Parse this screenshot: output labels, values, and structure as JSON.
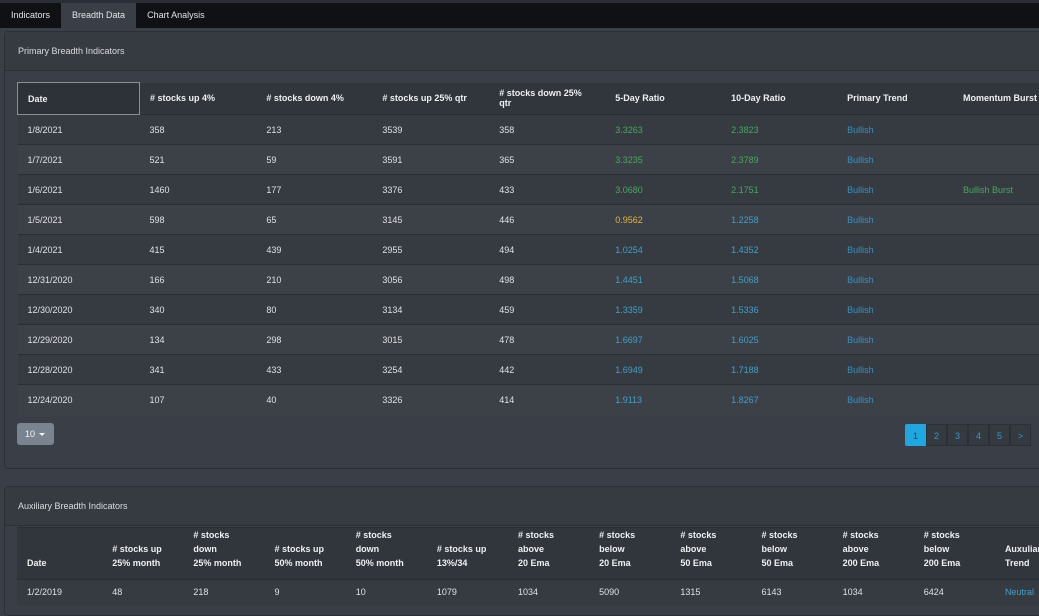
{
  "tabs": [
    {
      "label": "Indicators",
      "active": false
    },
    {
      "label": "Breadth Data",
      "active": true
    },
    {
      "label": "Chart Analysis",
      "active": false
    }
  ],
  "primary": {
    "title": "Primary Breadth Indicators",
    "columns": [
      "Date",
      "# stocks up 4%",
      "# stocks down 4%",
      "# stocks up 25% qtr",
      "# stocks down 25% qtr",
      "5-Day Ratio",
      "10-Day Ratio",
      "Primary Trend",
      "Momentum Burst"
    ],
    "rows": [
      {
        "date": "1/8/2021",
        "up4": "358",
        "down4": "213",
        "up25q": "3539",
        "down25q": "358",
        "r5": "3.3263",
        "r5c": "pos",
        "r10": "2.3823",
        "r10c": "pos",
        "trend": "Bullish",
        "burst": ""
      },
      {
        "date": "1/7/2021",
        "up4": "521",
        "down4": "59",
        "up25q": "3591",
        "down25q": "365",
        "r5": "3.3235",
        "r5c": "pos",
        "r10": "2.3789",
        "r10c": "pos",
        "trend": "Bullish",
        "burst": ""
      },
      {
        "date": "1/6/2021",
        "up4": "1460",
        "down4": "177",
        "up25q": "3376",
        "down25q": "433",
        "r5": "3.0680",
        "r5c": "pos",
        "r10": "2.1751",
        "r10c": "pos",
        "trend": "Bullish",
        "burst": "Bullish Burst"
      },
      {
        "date": "1/5/2021",
        "up4": "598",
        "down4": "65",
        "up25q": "3145",
        "down25q": "446",
        "r5": "0.9562",
        "r5c": "warn",
        "r10": "1.2258",
        "r10c": "info",
        "trend": "Bullish",
        "burst": ""
      },
      {
        "date": "1/4/2021",
        "up4": "415",
        "down4": "439",
        "up25q": "2955",
        "down25q": "494",
        "r5": "1.0254",
        "r5c": "info",
        "r10": "1.4352",
        "r10c": "info",
        "trend": "Bullish",
        "burst": ""
      },
      {
        "date": "12/31/2020",
        "up4": "166",
        "down4": "210",
        "up25q": "3056",
        "down25q": "498",
        "r5": "1.4451",
        "r5c": "info",
        "r10": "1.5068",
        "r10c": "info",
        "trend": "Bullish",
        "burst": ""
      },
      {
        "date": "12/30/2020",
        "up4": "340",
        "down4": "80",
        "up25q": "3134",
        "down25q": "459",
        "r5": "1.3359",
        "r5c": "info",
        "r10": "1.5336",
        "r10c": "info",
        "trend": "Bullish",
        "burst": ""
      },
      {
        "date": "12/29/2020",
        "up4": "134",
        "down4": "298",
        "up25q": "3015",
        "down25q": "478",
        "r5": "1.6697",
        "r5c": "info",
        "r10": "1.6025",
        "r10c": "info",
        "trend": "Bullish",
        "burst": ""
      },
      {
        "date": "12/28/2020",
        "up4": "341",
        "down4": "433",
        "up25q": "3254",
        "down25q": "442",
        "r5": "1.6949",
        "r5c": "info",
        "r10": "1.7188",
        "r10c": "info",
        "trend": "Bullish",
        "burst": ""
      },
      {
        "date": "12/24/2020",
        "up4": "107",
        "down4": "40",
        "up25q": "3326",
        "down25q": "414",
        "r5": "1.9113",
        "r5c": "info",
        "r10": "1.8267",
        "r10c": "info",
        "trend": "Bullish",
        "burst": ""
      }
    ],
    "page_size": "10",
    "pages": [
      "1",
      "2",
      "3",
      "4",
      "5",
      ">"
    ],
    "current_page": "1"
  },
  "auxiliary": {
    "title": "Auxiliary Breadth Indicators",
    "columns": [
      [
        "Date",
        ""
      ],
      [
        "# stocks up",
        "25% month"
      ],
      [
        "# stocks down",
        "25% month"
      ],
      [
        "# stocks up",
        "50% month"
      ],
      [
        "# stocks down",
        "50% month"
      ],
      [
        "# stocks up",
        "13%/34"
      ],
      [
        "# stocks above",
        "20 Ema"
      ],
      [
        "# stocks below",
        "20 Ema"
      ],
      [
        "# stocks above",
        "50 Ema"
      ],
      [
        "# stocks below",
        "50 Ema"
      ],
      [
        "# stocks above",
        "200 Ema"
      ],
      [
        "# stocks below",
        "200 Ema"
      ],
      [
        "Auxuliary",
        "Trend"
      ]
    ],
    "rows": [
      [
        "1/2/2019",
        "48",
        "218",
        "9",
        "10",
        "1079",
        "1034",
        "5090",
        "1315",
        "6143",
        "1034",
        "6424",
        "Neutral"
      ]
    ]
  },
  "colors": {
    "positive": "#46a85a",
    "warning": "#e8b43c",
    "info": "#3ea1c9",
    "accent": "#1fa7e0"
  }
}
